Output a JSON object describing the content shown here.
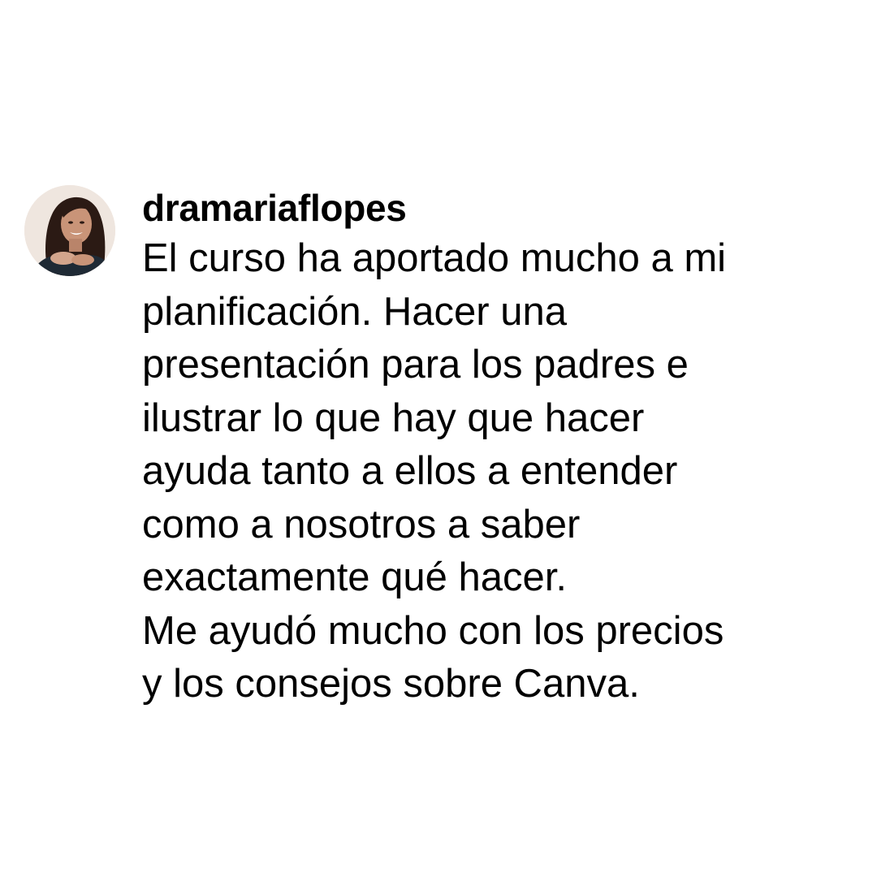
{
  "comment": {
    "username": "dramariaflopes",
    "avatar_icon": "profile-photo",
    "lines": [
      "El curso ha aportado mucho a mi",
      "planificación. Hacer una",
      "presentación para los padres e",
      "ilustrar lo que hay que hacer",
      "ayuda tanto a ellos a entender",
      "como a nosotros a saber",
      "exactamente qué hacer.",
      "Me ayudó mucho con los precios",
      "y los consejos sobre Canva."
    ]
  }
}
